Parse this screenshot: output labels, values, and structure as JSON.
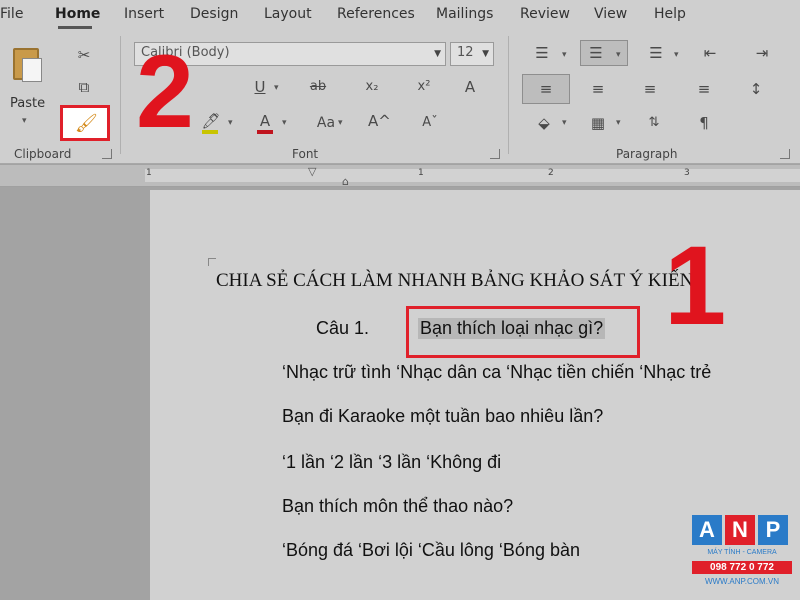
{
  "tabs": [
    "File",
    "Home",
    "Insert",
    "Design",
    "Layout",
    "References",
    "Mailings",
    "Review",
    "View",
    "Help"
  ],
  "ribbon": {
    "clipboard": {
      "paste_label": "Paste",
      "group_label": "Clipboard"
    },
    "font": {
      "font_name": "Calibri (Body)",
      "font_size": "12",
      "group_label": "Font"
    },
    "paragraph": {
      "group_label": "Paragraph"
    }
  },
  "ruler": {
    "numbers": [
      "1",
      "1",
      "2",
      "3"
    ]
  },
  "document": {
    "title": "CHIA SẺ CÁCH LÀM NHANH BẢNG KHẢO SÁT Ý KIẾN",
    "q1_label": "Câu 1.",
    "q1_text": "Bạn thích loại nhạc gì?",
    "q1_options": "‘Nhạc trữ tình ‘Nhạc dân ca ‘Nhạc tiền chiến ‘Nhạc trẻ",
    "q2_text": "Bạn đi Karaoke một tuần bao nhiêu lần?",
    "q2_options": "‘1 lần ‘2 lần ‘3 lần ‘Không đi",
    "q3_text": "Bạn thích môn thể thao nào?",
    "q3_options": "‘Bóng đá ‘Bơi lội ‘Cầu lông ‘Bóng bàn"
  },
  "annotations": {
    "step1": "1",
    "step2": "2"
  },
  "logo": {
    "letters": [
      "A",
      "N",
      "P"
    ],
    "tagline": "MÁY TÍNH - CAMERA",
    "phone": "098 772 0 772",
    "website": "WWW.ANP.COM.VN"
  },
  "colors": {
    "annotation_red": "#e0202a",
    "logo_blue": "#2a7bc8"
  }
}
